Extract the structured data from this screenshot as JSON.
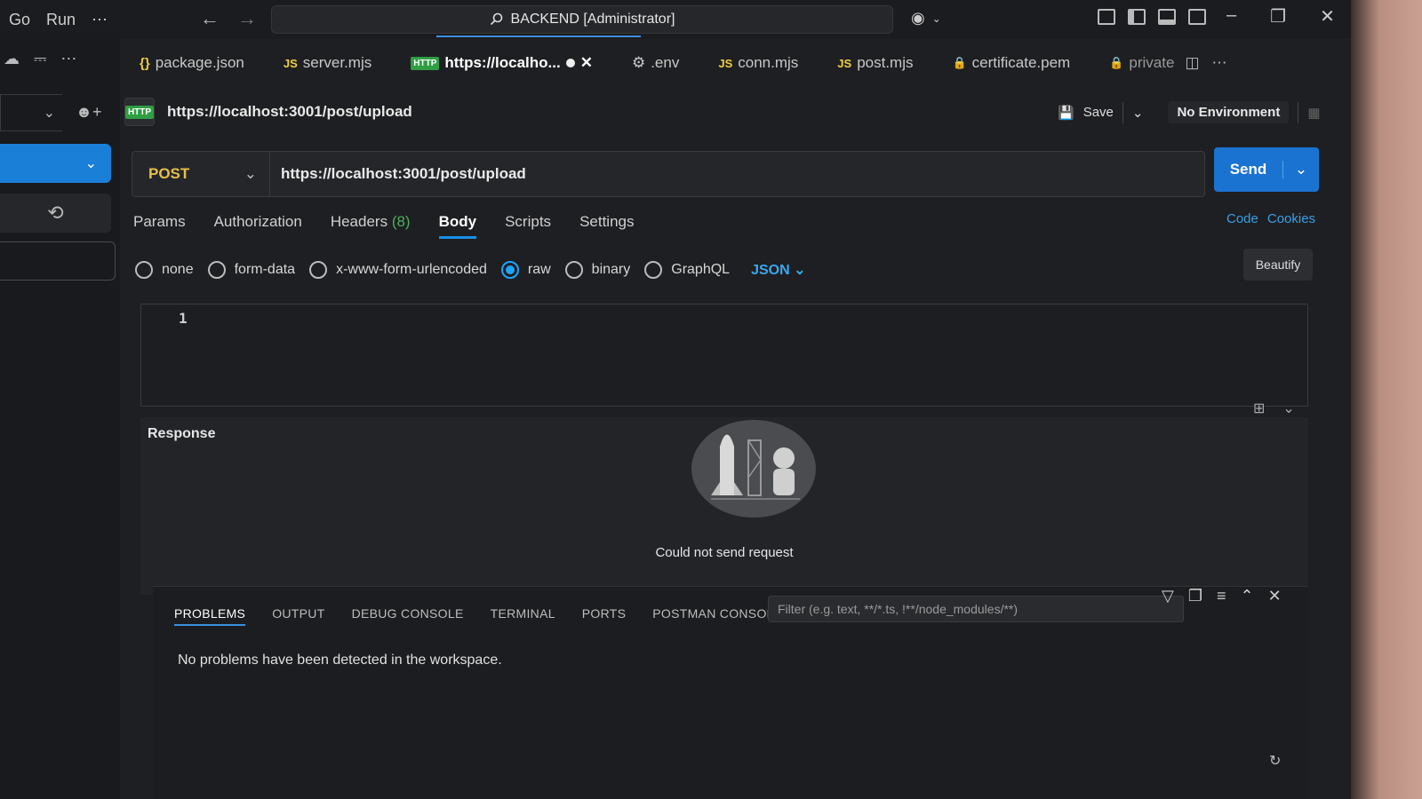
{
  "menu": [
    "Go",
    "Run",
    "⋯"
  ],
  "command_center": "BACKEND [Administrator]",
  "tabs": [
    {
      "badge": "{}",
      "label": "package.json",
      "type": "json"
    },
    {
      "badge": "JS",
      "label": "server.mjs",
      "type": "js"
    },
    {
      "badge": "HTTP",
      "label": "https://localho...",
      "type": "http",
      "active": true,
      "dirty": true
    },
    {
      "badge": "⚙",
      "label": ".env",
      "type": "env"
    },
    {
      "badge": "JS",
      "label": "conn.mjs",
      "type": "js"
    },
    {
      "badge": "JS",
      "label": "post.mjs",
      "type": "js"
    },
    {
      "badge": "🔒",
      "label": "certificate.pem",
      "type": "lock"
    },
    {
      "badge": "🔒",
      "label": "private",
      "type": "lock"
    }
  ],
  "request": {
    "title": "https://localhost:3001/post/upload",
    "save_label": "Save",
    "environment": "No Environment",
    "method": "POST",
    "url": "https://localhost:3001/post/upload",
    "send_label": "Send"
  },
  "request_tabs": {
    "params": "Params",
    "authorization": "Authorization",
    "headers": "Headers",
    "headers_count": "(8)",
    "body": "Body",
    "scripts": "Scripts",
    "settings": "Settings"
  },
  "links": {
    "code": "Code",
    "cookies": "Cookies"
  },
  "body_options": {
    "none": "none",
    "form_data": "form-data",
    "urlencoded": "x-www-form-urlencoded",
    "raw": "raw",
    "binary": "binary",
    "graphql": "GraphQL",
    "format": "JSON",
    "selected": "raw"
  },
  "beautify_label": "Beautify",
  "editor": {
    "line_number": "1"
  },
  "response": {
    "title": "Response",
    "message": "Could not send request"
  },
  "panel": {
    "tabs": [
      "PROBLEMS",
      "OUTPUT",
      "DEBUG CONSOLE",
      "TERMINAL",
      "PORTS",
      "POSTMAN CONSOLE"
    ],
    "active_tab": "PROBLEMS",
    "filter_placeholder": "Filter (e.g. text, **/*.ts, !**/node_modules/**)",
    "message": "No problems have been detected in the workspace."
  },
  "colors": {
    "accent": "#1a73d1",
    "method": "#e7c04a",
    "headers_count": "#49b35a"
  }
}
